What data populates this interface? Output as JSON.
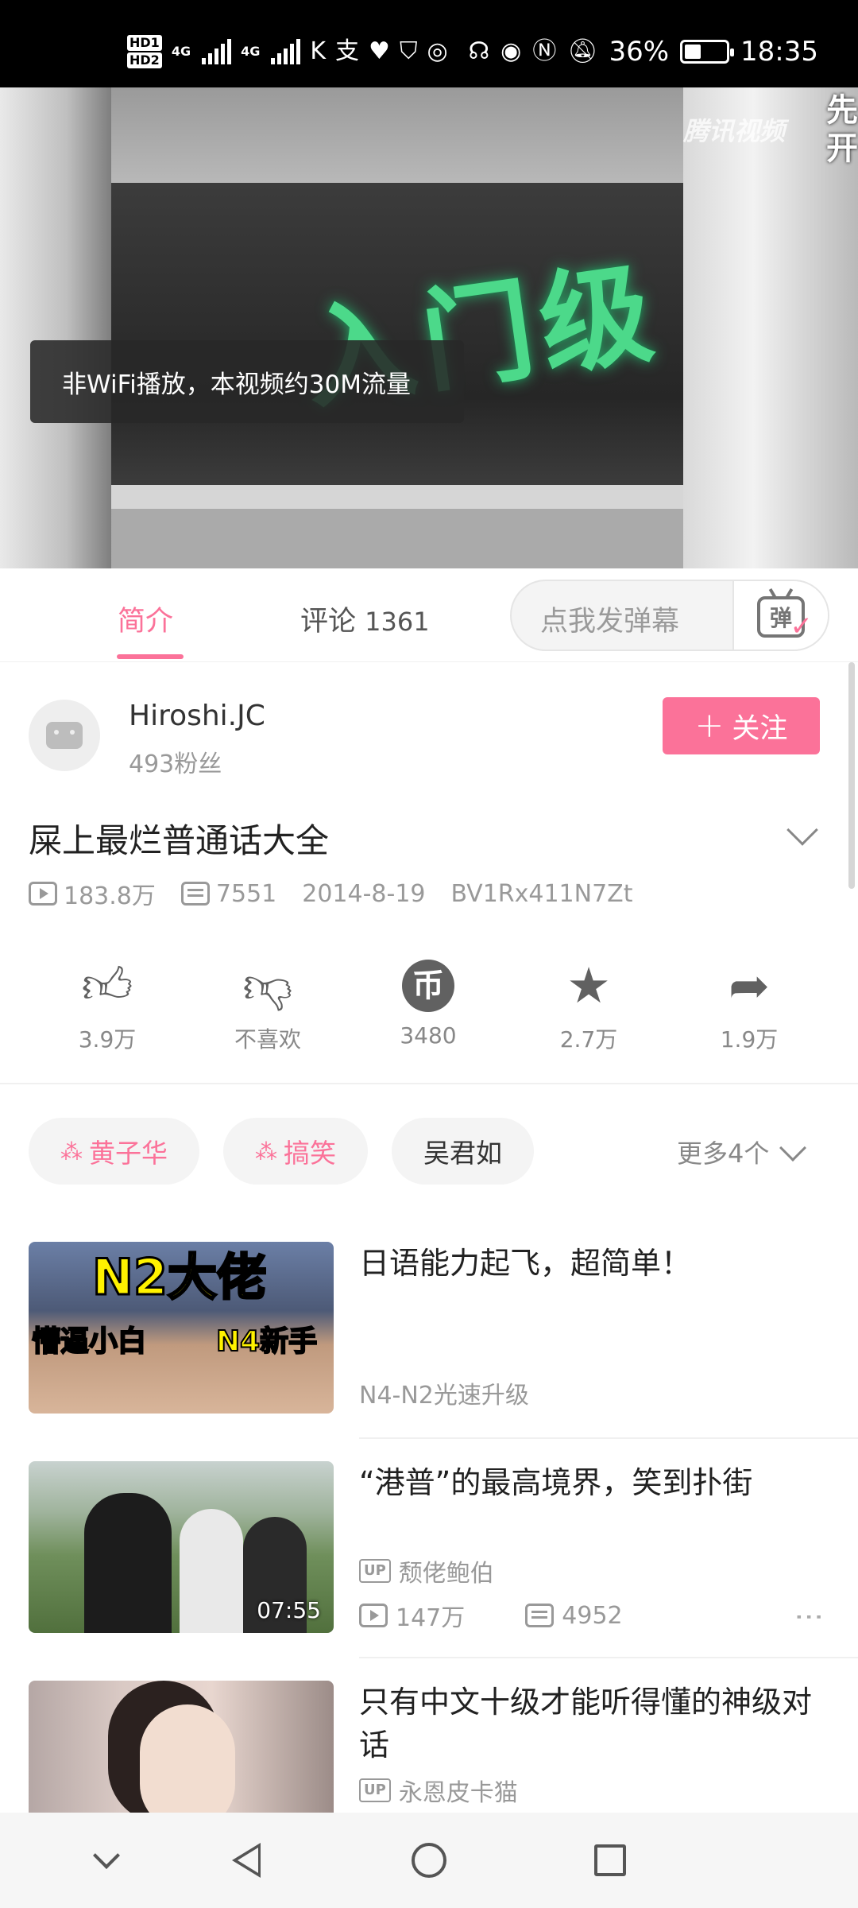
{
  "status_bar": {
    "hd1": "HD1",
    "hd2": "HD2",
    "net1": "4G",
    "net2": "4G",
    "battery_percent": "36%",
    "battery_level": 0.36,
    "time": "18:35",
    "icons": [
      "k-icon",
      "alipay-icon",
      "health-heart-icon",
      "shield-icon",
      "hotspot-icon",
      "headset-icon",
      "eye-icon",
      "nfc-icon",
      "mute-bell-icon"
    ]
  },
  "video": {
    "watermark": "腾讯视频",
    "overlay_text": "入门级",
    "corner_text": "先 开",
    "toast": "非WiFi播放，本视频约30M流量"
  },
  "tabs": {
    "intro": "简介",
    "comments_label": "评论",
    "comments_count": "1361",
    "danmaku_placeholder": "点我发弹幕",
    "danmaku_icon_char": "弹"
  },
  "uploader": {
    "name": "Hiroshi.JC",
    "fans": "493粉丝",
    "follow_label": "关注"
  },
  "video_info": {
    "title": "屎上最烂普通话大全",
    "views": "183.8万",
    "danmaku": "7551",
    "date": "2014-8-19",
    "bvid": "BV1Rx411N7Zt"
  },
  "actions": {
    "like": "3.9万",
    "dislike": "不喜欢",
    "coin": "3480",
    "coin_char": "币",
    "favorite": "2.7万",
    "share": "1.9万"
  },
  "tags": {
    "items": [
      "黄子华",
      "搞笑",
      "吴君如"
    ],
    "more": "更多4个"
  },
  "related": [
    {
      "title": "日语能力起飞，超简单！",
      "subtitle": "N4-N2光速升级",
      "thumb_big": "N2大佬",
      "thumb_left": "懵逼小白",
      "thumb_right": "N4新手"
    },
    {
      "title": "“港普”的最高境界，笑到扑街",
      "up_badge": "UP",
      "up_name": "颓佬鲍伯",
      "views": "147万",
      "danmaku": "4952",
      "duration": "07:55"
    },
    {
      "title": "只有中文十级才能听得懂的神级对话",
      "up_badge": "UP",
      "up_name": "永恩皮卡猫"
    }
  ],
  "colors": {
    "accent": "#fb7299",
    "text_primary": "#212121",
    "text_secondary": "#999999"
  }
}
